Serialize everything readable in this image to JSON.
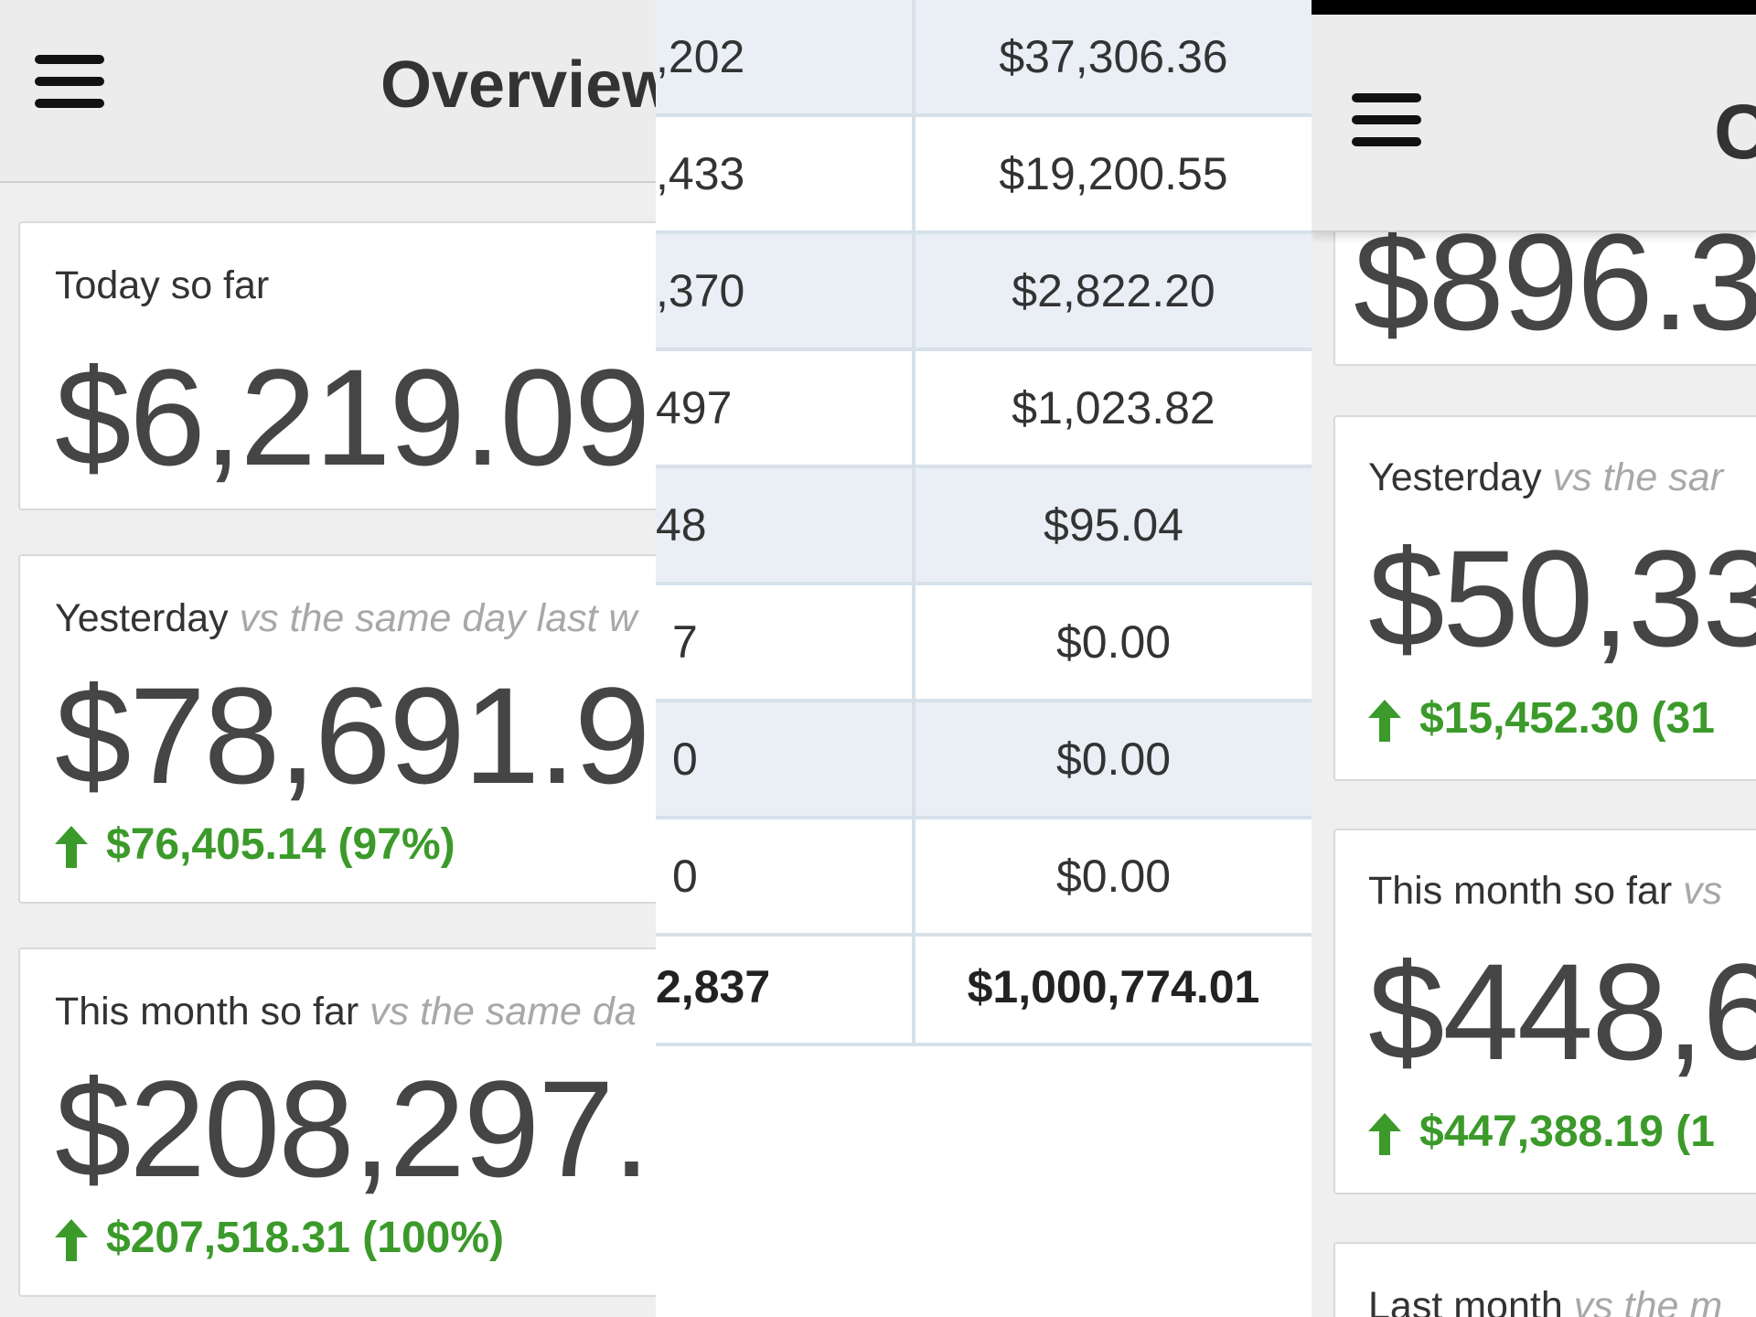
{
  "left": {
    "nav": {
      "title": "Overview"
    },
    "cards": [
      {
        "label": "Today so far",
        "label_muted": "",
        "value": "$6,219.09",
        "delta": ""
      },
      {
        "label": "Yesterday",
        "label_muted": "vs the same day last w",
        "value": "$78,691.9",
        "delta": "$76,405.14 (97%)"
      },
      {
        "label": "This month so far",
        "label_muted": "vs the same da",
        "value": "$208,297.",
        "delta": "$207,518.31 (100%)"
      }
    ]
  },
  "middle": {
    "rows": [
      {
        "left": ",202",
        "right": "$37,306.36"
      },
      {
        "left": ",433",
        "right": "$19,200.55"
      },
      {
        "left": ",370",
        "right": "$2,822.20"
      },
      {
        "left": "497",
        "right": "$1,023.82"
      },
      {
        "left": "48",
        "right": "$95.04"
      },
      {
        "left": "7",
        "right": "$0.00"
      },
      {
        "left": "0",
        "right": "$0.00"
      },
      {
        "left": "0",
        "right": "$0.00"
      }
    ],
    "total": {
      "left": "2,837",
      "right": "$1,000,774.01"
    }
  },
  "right": {
    "nav": {
      "title": "C"
    },
    "top_value": "$896.3",
    "cards": [
      {
        "label": "Yesterday",
        "label_muted": "vs the sar",
        "value": "$50,33",
        "delta": "$15,452.30 (31"
      },
      {
        "label": "This month so far",
        "label_muted": "vs",
        "value": "$448,6",
        "delta": "$447,388.19 (1"
      },
      {
        "label": "Last month",
        "label_muted": "vs the m",
        "value": "",
        "delta": ""
      }
    ]
  },
  "colors": {
    "positive": "#3b9a2a",
    "value_text": "#454545",
    "muted_text": "#a8a8a8",
    "table_alt_row": "#e9eff4"
  }
}
